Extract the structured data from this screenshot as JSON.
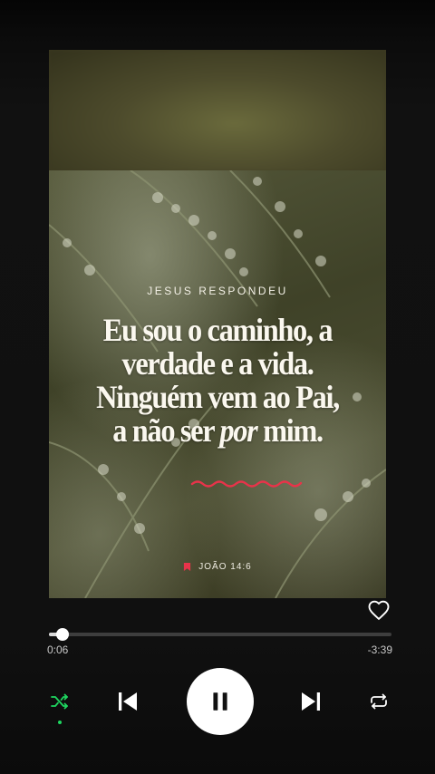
{
  "artwork": {
    "kicker": "JESUS RESPONDEU",
    "quote_lines": [
      "Eu sou o caminho, a",
      "verdade e a vida.",
      "Ninguém vem ao Pai,"
    ],
    "quote_last_prefix": "a não ser ",
    "quote_last_emphasis": "por",
    "quote_last_suffix": " mim.",
    "reference": "JOÃO 14:6",
    "accent_color": "#e8334a"
  },
  "player": {
    "elapsed": "0:06",
    "remaining": "-3:39",
    "progress_fraction": 0.04,
    "liked": false,
    "state": "playing",
    "shuffle_active": true,
    "shuffle_color": "#1ed760"
  },
  "icons": {
    "like": "heart-outline-icon",
    "shuffle": "shuffle-icon",
    "previous": "skip-previous-icon",
    "play_pause": "pause-icon",
    "next": "skip-next-icon",
    "repeat": "repeat-icon"
  }
}
